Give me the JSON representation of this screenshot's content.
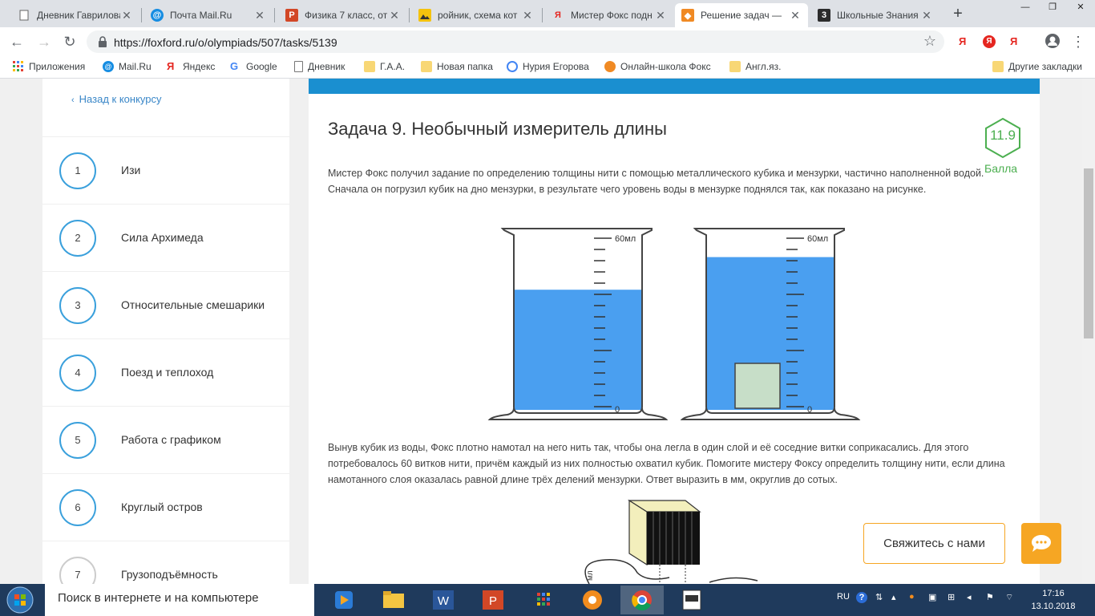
{
  "browser": {
    "tabs": [
      {
        "title": "Дневник Гаврилова",
        "icon": "doc-icon"
      },
      {
        "title": "Почта Mail.Ru",
        "icon": "mailru-icon"
      },
      {
        "title": "Физика 7 класс, от",
        "icon": "presentation-icon"
      },
      {
        "title": "ройник, схема кот",
        "icon": "image-icon"
      },
      {
        "title": "Мистер Фокс подн",
        "icon": "yandex-icon"
      },
      {
        "title": "Решение задач —",
        "icon": "foxford-icon",
        "active": true
      },
      {
        "title": "Школьные Знания",
        "icon": "znanija-icon"
      }
    ],
    "url": "https://foxford.ru/o/olympiads/507/tasks/5139",
    "bookmarks": [
      {
        "label": "Приложения",
        "icon": "apps-icon"
      },
      {
        "label": "Mail.Ru",
        "icon": "mailru-icon"
      },
      {
        "label": "Яндекс",
        "icon": "yandex-icon"
      },
      {
        "label": "Google",
        "icon": "google-icon"
      },
      {
        "label": "Дневник",
        "icon": "doc-icon"
      },
      {
        "label": "Г.А.А.",
        "icon": "folder-icon"
      },
      {
        "label": "Новая папка",
        "icon": "folder-icon"
      },
      {
        "label": "Нурия Егорова",
        "icon": "globe-icon"
      },
      {
        "label": "Онлайн-школа Фокс",
        "icon": "foxford-icon"
      },
      {
        "label": "Англ.яз.",
        "icon": "folder-icon"
      }
    ],
    "other_bookmarks": "Другие закладки",
    "extension_letters": [
      "Я",
      "Я",
      "Я"
    ]
  },
  "sidebar": {
    "back_label": "Назад к конкурсу",
    "tasks": [
      {
        "num": "1",
        "title": "Изи"
      },
      {
        "num": "2",
        "title": "Сила Архимеда"
      },
      {
        "num": "3",
        "title": "Относительные смешарики"
      },
      {
        "num": "4",
        "title": "Поезд и теплоход"
      },
      {
        "num": "5",
        "title": "Работа с графиком"
      },
      {
        "num": "6",
        "title": "Круглый остров"
      },
      {
        "num": "7",
        "title": "Грузоподъёмность"
      }
    ]
  },
  "task": {
    "heading": "Задача 9. Необычный измеритель длины",
    "score": "11.9",
    "score_label": "Балла",
    "paragraph1": "Мистер Фокс получил задание по определению толщины нити с помощью металлического кубика и мензурки, частично наполненной водой. Сначала он погрузил кубик на дно мензурки, в результате чего уровень воды в мензурке поднялся так, как показано на рисунке.",
    "paragraph2": "Вынув кубик из воды, Фокс плотно намотал на него нить так, чтобы она легла в один слой и её соседние витки соприкасались. Для этого потребовалось 60 витков нити, причём каждый из них полностью охватил кубик. Помогите мистеру Фоксу определить толщину нити, если длина намотанного слоя оказалась равной длине трёх делений мензурки. Ответ выразить в мм, округлив до сотых.",
    "beaker_top_label": "60мл",
    "beaker_bottom_label": "0",
    "beaker_left_level": 0.7,
    "beaker_right_level": 0.89,
    "spool_label": "мл"
  },
  "contact_label": "Свяжитесь с нами",
  "taskbar": {
    "search_placeholder": "Поиск в интернете и на компьютере",
    "lang": "RU",
    "time": "17:16",
    "date": "13.10.2018"
  },
  "colors": {
    "accent": "#1a8fd0",
    "water": "#4a9ff0",
    "score_green": "#4caf50",
    "contact_orange": "#f6a623"
  }
}
